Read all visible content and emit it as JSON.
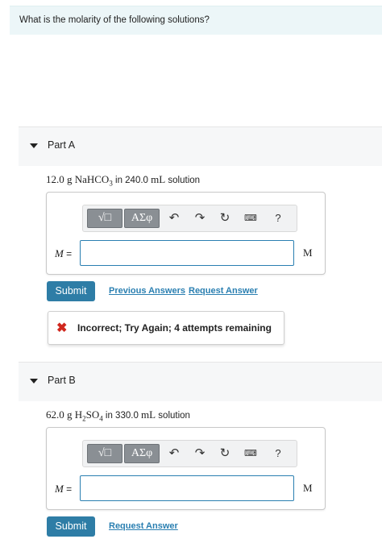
{
  "question": "What is the molarity of the following solutions?",
  "toolbar": {
    "templates_label": "√□",
    "symbols_label": "ΑΣφ",
    "undo_icon": "undo-arrow",
    "redo_icon": "redo-arrow",
    "reset_icon": "reset-circle",
    "keyboard_icon": "keyboard",
    "help_label": "?"
  },
  "part_a": {
    "title": "Part A",
    "amount": "12.0 g",
    "formula_prefix": "NaHCO",
    "formula_sub": "3",
    "middle_text": " in 240.0 ",
    "volume_unit": "mL",
    "suffix_text": " solution",
    "variable": "M",
    "equals": " =",
    "input_value": "",
    "unit": "M",
    "submit_label": "Submit",
    "previous_answers_label": "Previous Answers",
    "request_answer_label": "Request Answer",
    "feedback": "Incorrect; Try Again; 4 attempts remaining"
  },
  "part_b": {
    "title": "Part B",
    "amount": "62.0 g",
    "formula_prefix_1": "H",
    "formula_sub_1": "2",
    "formula_prefix_2": "SO",
    "formula_sub_2": "4",
    "middle_text": " in 330.0 ",
    "volume_unit": "mL",
    "suffix_text": " solution",
    "variable": "M",
    "equals": " =",
    "input_value": "",
    "unit": "M",
    "submit_label": "Submit",
    "request_answer_label": "Request Answer"
  },
  "colors": {
    "accent": "#2e7da6",
    "error": "#d0271d",
    "intro_bg": "#ecf6f8"
  }
}
